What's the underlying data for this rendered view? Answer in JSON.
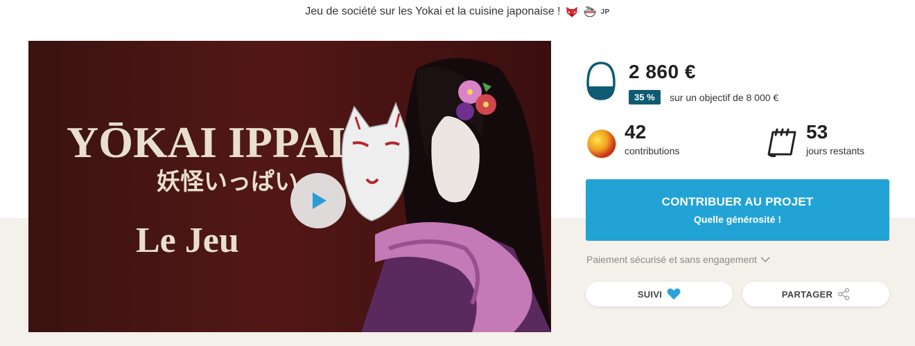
{
  "header": {
    "tagline": "Jeu de société sur les Yokai et la cuisine japonaise !",
    "emoji_icons": [
      "fox-mask-icon",
      "ramen-bowl-icon"
    ],
    "language": "JP"
  },
  "video": {
    "title_line1": "YŌKAI IPPAI",
    "title_japanese": "妖怪いっぱい",
    "title_line2": "Le Jeu",
    "play_icon": "play-icon"
  },
  "funding": {
    "amount": "2 860 €",
    "percent": "35 %",
    "percent_value": 35,
    "goal_text": "sur un objectif de 8 000 €",
    "fill_color": "#0e5b73"
  },
  "stats": {
    "contributions_count": "42",
    "contributions_label": "contributions",
    "days_count": "53",
    "days_label": "jours restants"
  },
  "cta": {
    "title": "CONTRIBUER AU PROJET",
    "subtitle": "Quelle générosité !",
    "color": "#22a3d5"
  },
  "secure_payment": "Paiement sécurisé et sans engagement",
  "buttons": {
    "follow": "SUIVI",
    "share": "PARTAGER"
  },
  "colors": {
    "accent": "#22a3d5",
    "badge": "#0e5b73",
    "heart": "#29a3d8",
    "background_band": "#f4f0ea"
  }
}
